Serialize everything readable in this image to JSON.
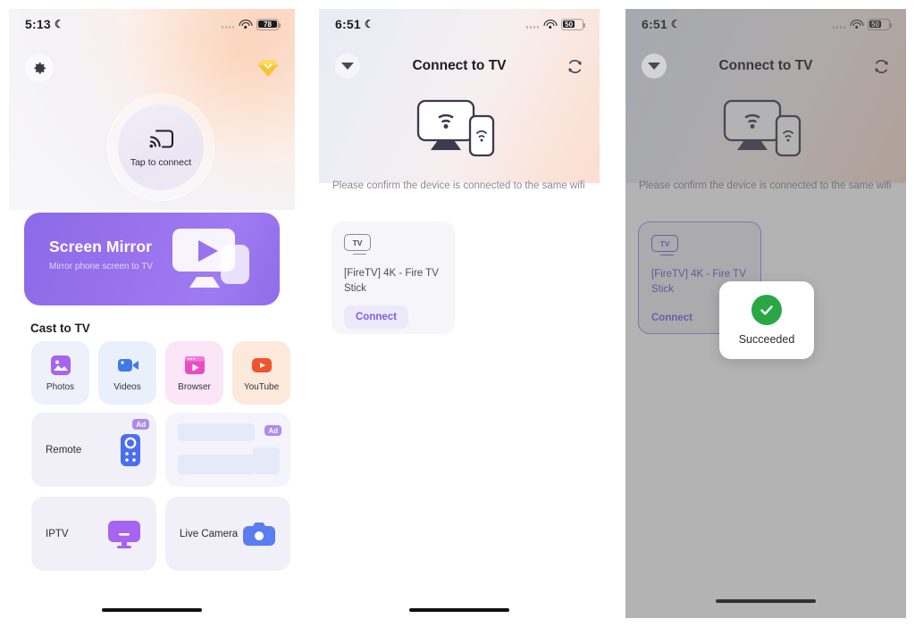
{
  "panel1": {
    "status": {
      "time": "5:13",
      "moon_icon": "moon-icon",
      "battery": "78",
      "wifi_icon": "wifi-icon",
      "signal_icon": "signal-dots-icon"
    },
    "settings_icon": "gear-icon",
    "premium_icon": "diamond-icon",
    "connect": {
      "label": "Tap to connect",
      "icon": "cast-icon"
    },
    "mirror_card": {
      "title": "Screen Mirror",
      "subtitle": "Mirror phone screen to TV",
      "icon": "tv-play-icon"
    },
    "section_title": "Cast to TV",
    "tiles": [
      {
        "label": "Photos",
        "icon": "photo-icon"
      },
      {
        "label": "Videos",
        "icon": "video-camera-icon"
      },
      {
        "label": "Browser",
        "icon": "browser-icon"
      },
      {
        "label": "YouTube",
        "icon": "youtube-icon"
      }
    ],
    "row2": {
      "remote_label": "Remote",
      "remote_icon": "remote-control-icon",
      "ad_badge": "Ad",
      "ad_badge2": "Ad"
    },
    "row3": [
      {
        "label": "IPTV",
        "icon": "monitor-icon"
      },
      {
        "label": "Live Camera",
        "icon": "camera-icon"
      }
    ]
  },
  "panel2": {
    "status": {
      "time": "6:51",
      "battery": "50"
    },
    "header": {
      "title": "Connect to TV",
      "back_icon": "chevron-down-icon",
      "refresh_icon": "refresh-icon"
    },
    "art_icon": "tv-phone-wifi-icon",
    "hint": "Please confirm the device is connected to the same wifi",
    "device": {
      "badge": "TV",
      "name": "[FireTV] 4K - Fire TV Stick",
      "button": "Connect"
    }
  },
  "panel3": {
    "status": {
      "time": "6:51",
      "battery": "50"
    },
    "header": {
      "title": "Connect to TV",
      "back_icon": "chevron-down-icon",
      "refresh_icon": "refresh-icon"
    },
    "hint": "Please confirm the device is connected to the same wifi",
    "device": {
      "badge": "TV",
      "name": "[FireTV] 4K - Fire TV Stick",
      "button": "Connect"
    },
    "toast": {
      "label": "Succeeded",
      "icon": "check-circle-icon",
      "color": "#29a745"
    }
  }
}
